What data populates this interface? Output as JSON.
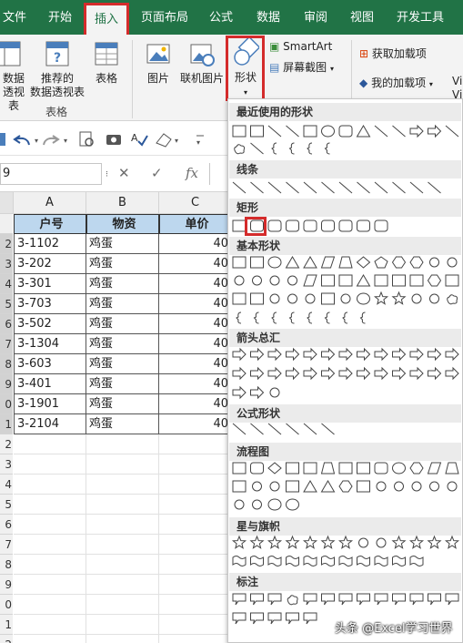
{
  "ribbon_tabs": [
    "文件",
    "开始",
    "插入",
    "页面布局",
    "公式",
    "数据",
    "审阅",
    "视图",
    "开发工具"
  ],
  "active_tab": "插入",
  "ribbon": {
    "pivot_label_line1": "数据",
    "pivot_label_line2": "透视表",
    "recommended_pivot_line1": "推荐的",
    "recommended_pivot_line2": "数据透视表",
    "table_label": "表格",
    "group_tables": "表格",
    "pictures_label": "图片",
    "online_pictures_label": "联机图片",
    "shapes_label": "形状",
    "smartart_label": "SmartArt",
    "screenshot_label": "屏幕截图",
    "get_addins_label": "获取加载项",
    "my_addins_label": "我的加载项",
    "vi_label_1": "Vi",
    "vi_label_2": "Vi"
  },
  "namebox": "9",
  "formula_symbols": {
    "cancel": "✕",
    "enter": "✓",
    "fx": "fx"
  },
  "columns": [
    "A",
    "B",
    "C"
  ],
  "rows": [
    "",
    "2",
    "3",
    "4",
    "5",
    "6",
    "7",
    "8",
    "9",
    "0",
    "1",
    "2",
    "3",
    "4",
    "5",
    "6",
    "7",
    "8",
    "9",
    "0",
    "1",
    "2"
  ],
  "table": {
    "headers": [
      "户号",
      "物资",
      "单价"
    ],
    "data": [
      [
        "3-1102",
        "鸡蛋",
        "40"
      ],
      [
        "3-202",
        "鸡蛋",
        "40"
      ],
      [
        "3-301",
        "鸡蛋",
        "40"
      ],
      [
        "3-703",
        "鸡蛋",
        "40"
      ],
      [
        "3-502",
        "鸡蛋",
        "40"
      ],
      [
        "3-1304",
        "鸡蛋",
        "40"
      ],
      [
        "3-603",
        "鸡蛋",
        "40"
      ],
      [
        "3-401",
        "鸡蛋",
        "40"
      ],
      [
        "3-1901",
        "鸡蛋",
        "40"
      ],
      [
        "3-2104",
        "鸡蛋",
        "40"
      ]
    ]
  },
  "gallery": {
    "sections": [
      "最近使用的形状",
      "线条",
      "矩形",
      "基本形状",
      "箭头总汇",
      "公式形状",
      "流程图",
      "星与旗帜",
      "标注"
    ]
  },
  "watermark": "头条 @Excel学习世界",
  "colors": {
    "excel_green": "#217346",
    "highlight_red": "#d42b2b",
    "header_fill": "#bdd7ee"
  }
}
